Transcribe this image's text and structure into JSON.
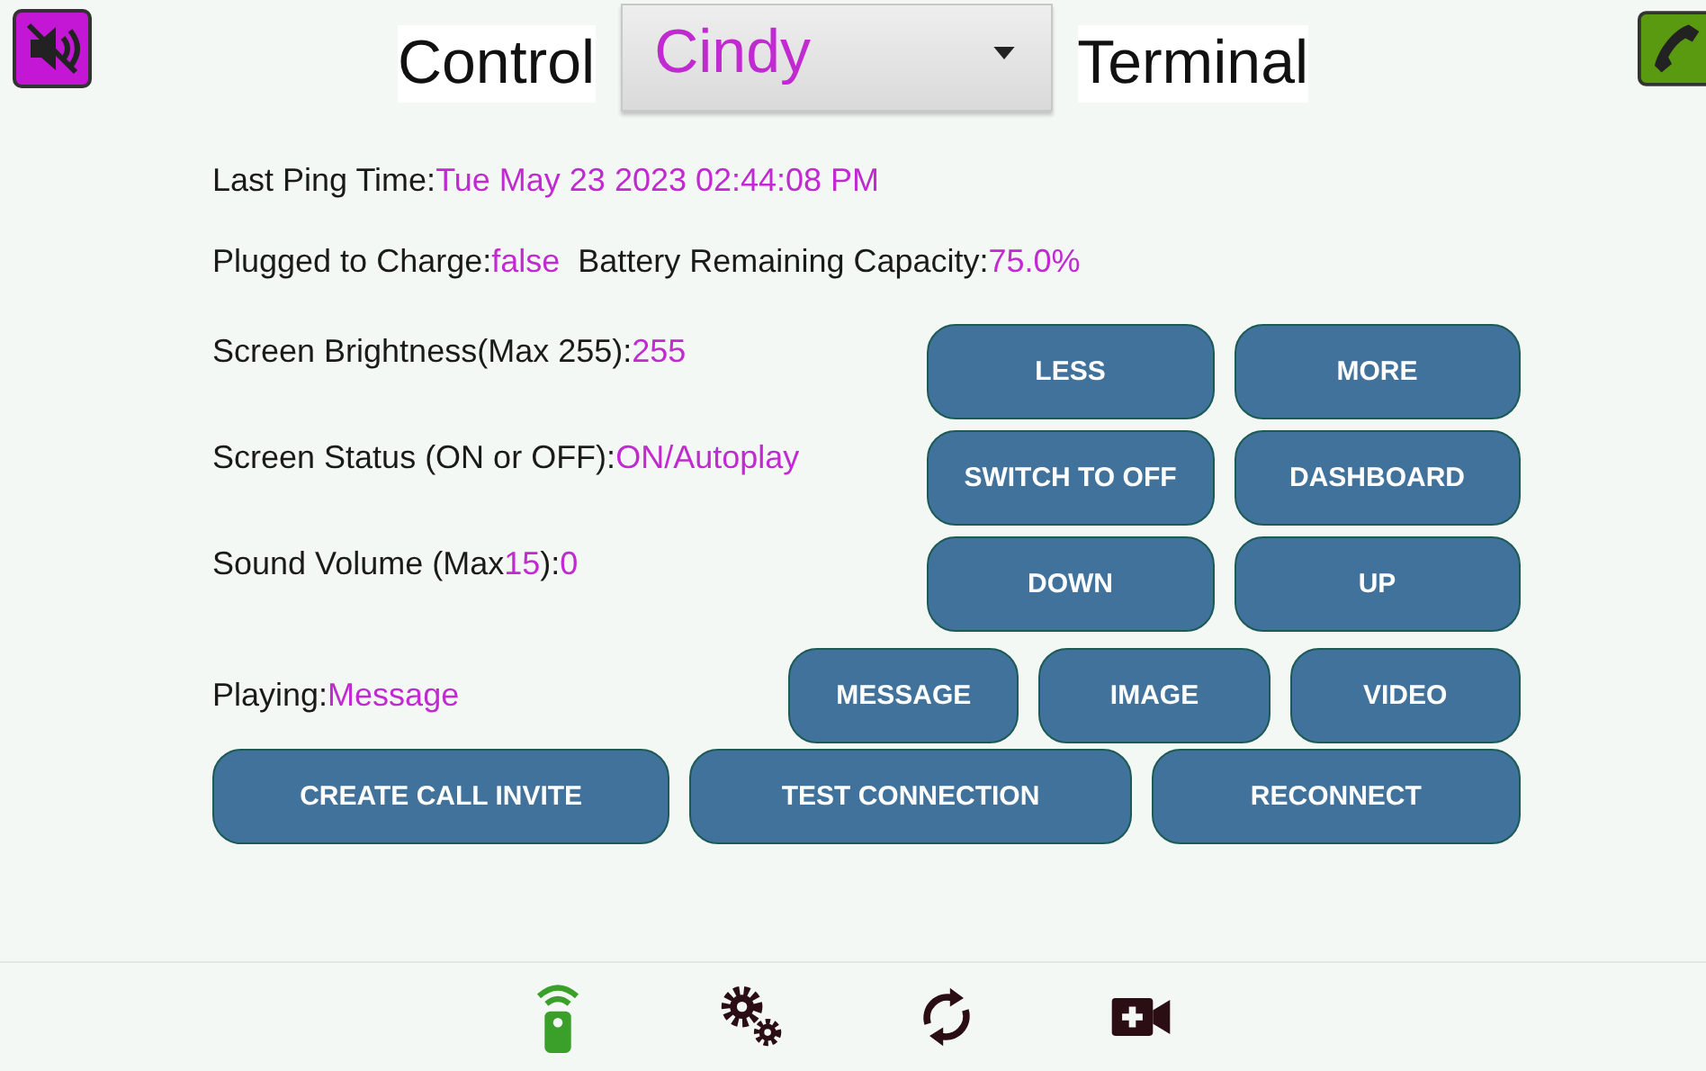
{
  "header": {
    "left_label": "Control",
    "dropdown": {
      "value": "Cindy"
    },
    "right_label": "Terminal"
  },
  "info_lines": [
    [
      {
        "kind": "label",
        "text": "Last Ping Time:"
      },
      {
        "kind": "value",
        "text": "Tue May 23 2023 02:44:08 PM"
      }
    ],
    [
      {
        "kind": "label",
        "text": "Plugged to Charge:"
      },
      {
        "kind": "value",
        "text": "false"
      },
      {
        "kind": "label",
        "text": "Battery Remaining Capacity:"
      },
      {
        "kind": "value",
        "text": "75.0%"
      }
    ]
  ],
  "control_rows": [
    {
      "parts": [
        {
          "kind": "label",
          "text": "Screen Brightness(Max 255):"
        },
        {
          "kind": "value",
          "text": "255"
        }
      ],
      "buttons": [
        "LESS",
        "MORE"
      ]
    },
    {
      "parts": [
        {
          "kind": "label",
          "text": "Screen Status (ON or OFF):"
        },
        {
          "kind": "value",
          "text": "ON/Autoplay"
        }
      ],
      "buttons": [
        "SWITCH TO OFF",
        "DASHBOARD"
      ]
    },
    {
      "parts": [
        {
          "kind": "label",
          "text": "Sound Volume (Max"
        },
        {
          "kind": "value",
          "text": "15"
        },
        {
          "kind": "label",
          "text": "):"
        },
        {
          "kind": "value",
          "text": "0"
        }
      ],
      "buttons": [
        "DOWN",
        "UP"
      ]
    },
    {
      "parts": [
        {
          "kind": "label",
          "text": "Playing:"
        },
        {
          "kind": "value",
          "text": "Message"
        }
      ],
      "buttons": [
        "MESSAGE",
        "IMAGE",
        "VIDEO"
      ]
    }
  ],
  "action_buttons": [
    "CREATE CALL INVITE",
    "TEST CONNECTION",
    "RECONNECT"
  ],
  "nav": [
    {
      "kind": "remote",
      "selected": true
    },
    {
      "kind": "gears",
      "selected": false
    },
    {
      "kind": "sync",
      "selected": false
    },
    {
      "kind": "video",
      "selected": false
    }
  ]
}
